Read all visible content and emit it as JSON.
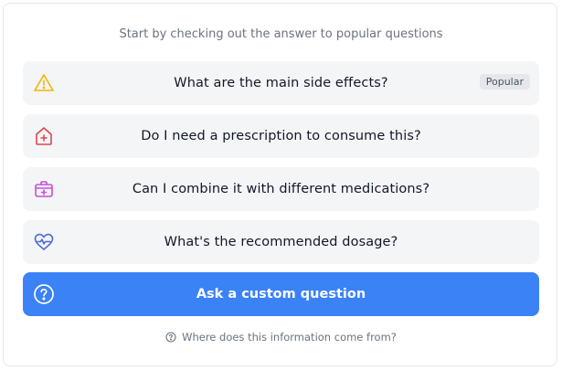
{
  "intro_text": "Start by checking out the answer to popular questions",
  "questions": [
    {
      "label": "What are the main side effects?",
      "icon": "warning-icon",
      "icon_color": "#f4b400",
      "badge": "Popular"
    },
    {
      "label": "Do I need a prescription to consume this?",
      "icon": "medical-house-icon",
      "icon_color": "#e0454f"
    },
    {
      "label": "Can I combine it with different medications?",
      "icon": "medical-kit-icon",
      "icon_color": "#c84fd6"
    },
    {
      "label": "What's the recommended dosage?",
      "icon": "heartbeat-icon",
      "icon_color": "#4a6bd6"
    }
  ],
  "custom_question": {
    "label": "Ask a custom question",
    "icon": "question-circle-icon",
    "bg_color": "#3b82f6"
  },
  "source_link": {
    "label": "Where does this information come from?",
    "icon": "help-circle-icon"
  }
}
